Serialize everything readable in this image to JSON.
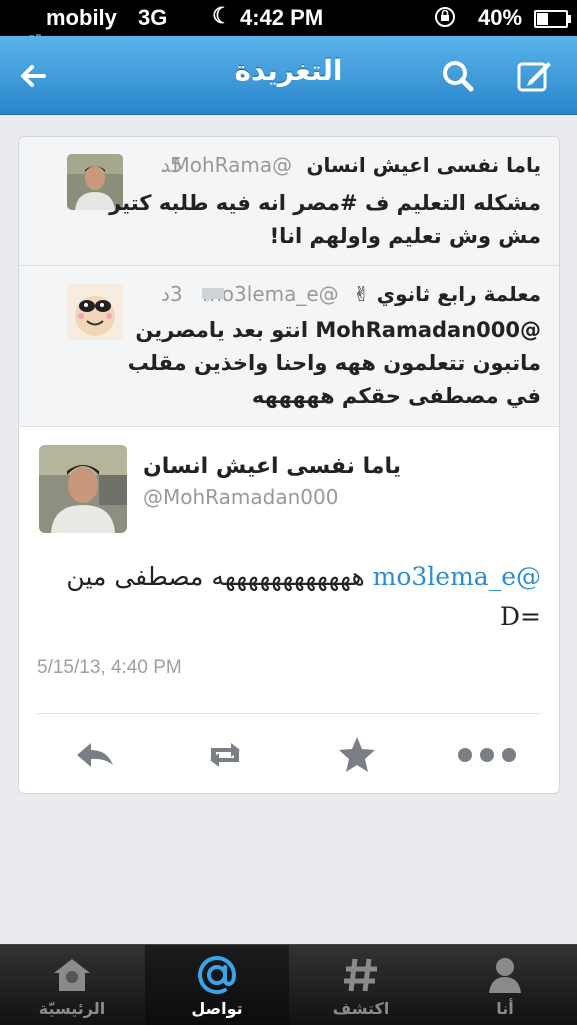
{
  "status_bar": {
    "carrier": "mobily",
    "network": "3G",
    "time": "4:42 PM",
    "battery_percent": "40%",
    "battery_level": 0.4
  },
  "nav": {
    "title": "التغريدة",
    "back_icon": "back-arrow-icon",
    "search_icon": "search-icon",
    "compose_icon": "compose-icon"
  },
  "conversation": [
    {
      "time_ago": "5د",
      "name": "ياما نفسى اعيش انسان",
      "handle": "@MohRama...",
      "text": "مشكله التعليم ف #مصر انه فيه طلبه كتير مش وش تعليم واولهم انا!"
    },
    {
      "time_ago": "3د",
      "name": "معلمة رابع ثانوي ✌",
      "handle": "@mo3lema_e",
      "text": "@MohRamadan000 انتو بعد يامصرين ماتبون تتعلمون ههه واحنا واخذين مقلب في مصطفى حقكم هههههه"
    }
  ],
  "main_tweet": {
    "name": "ياما نفسى اعيش انسان",
    "handle": "@MohRamadan000",
    "mention": "@mo3lema_e",
    "text": " ههههههههههههه مصطفى مين =D",
    "timestamp": "5/15/13, 4:40 PM",
    "actions": [
      "reply-icon",
      "retweet-icon",
      "favorite-star-icon",
      "more-icon"
    ]
  },
  "tabbar": {
    "home": "الرئيسيّة",
    "connect": "تواصل",
    "discover": "اكتشف",
    "me": "أنا",
    "active": "connect"
  }
}
